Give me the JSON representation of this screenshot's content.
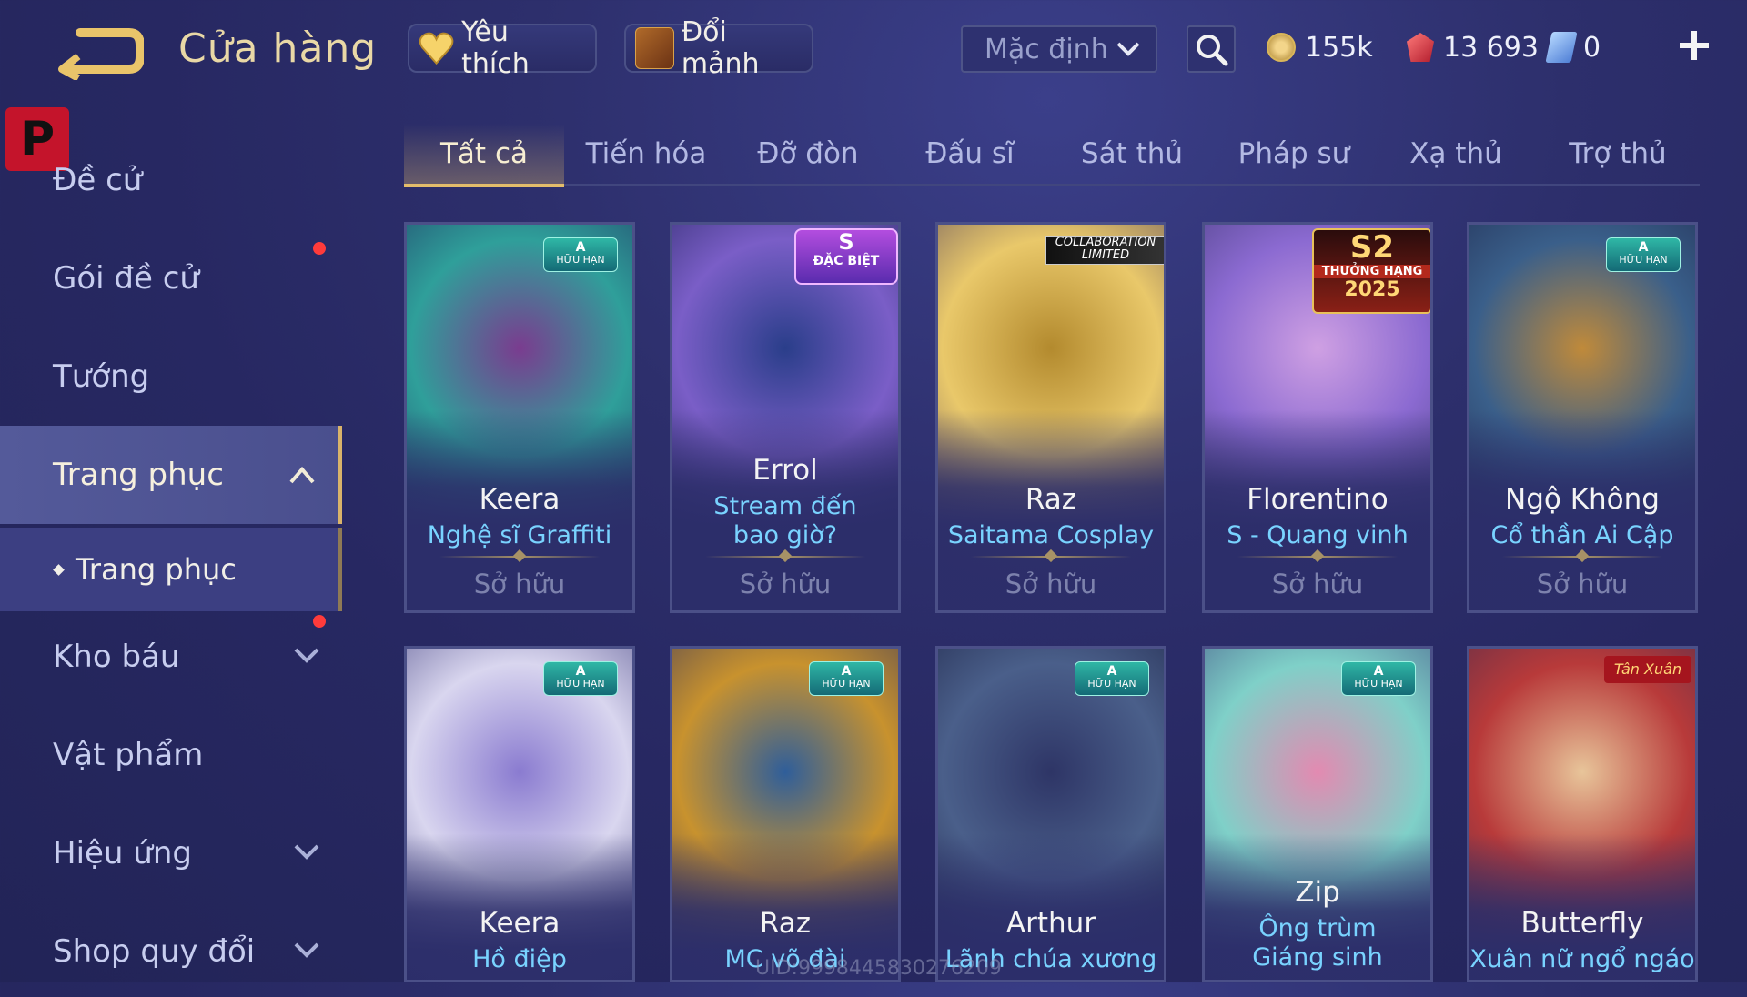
{
  "header": {
    "title": "Cửa hàng",
    "favorites_label": "Yêu thích",
    "shards_label": "Đổi mảnh",
    "sort": {
      "selected": "Mặc định"
    },
    "currencies": {
      "gold": "155k",
      "ruby": "13 693",
      "voucher": "0"
    }
  },
  "sidebar": {
    "logo_letter": "P",
    "items": [
      {
        "label": "Đề cử"
      },
      {
        "label": "Gói đề cử"
      },
      {
        "label": "Tướng"
      },
      {
        "label": "Trang phục"
      },
      {
        "label": "Trang phục"
      },
      {
        "label": "Kho báu"
      },
      {
        "label": "Vật phẩm"
      },
      {
        "label": "Hiệu ứng"
      },
      {
        "label": "Shop quy đổi"
      }
    ]
  },
  "tabs": [
    {
      "label": "Tất cả"
    },
    {
      "label": "Tiến hóa"
    },
    {
      "label": "Đỡ đòn"
    },
    {
      "label": "Đấu sĩ"
    },
    {
      "label": "Sát thủ"
    },
    {
      "label": "Pháp sư"
    },
    {
      "label": "Xạ thủ"
    },
    {
      "label": "Trợ thủ"
    }
  ],
  "cards": [
    {
      "hero": "Keera",
      "skin": "Nghệ sĩ Graffiti",
      "status": "Sở hữu",
      "badge_tier": "A",
      "badge_text": "HỮU HẠN",
      "art": [
        "#2f9f9a",
        "#7a3c8f",
        "#1f2a5e"
      ]
    },
    {
      "hero": "Errol",
      "skin": "Stream đến bao giờ?",
      "status": "Sở hữu",
      "badge_tier": "S",
      "badge_text": "ĐẶC BIỆT",
      "art": [
        "#7a5ec7",
        "#2a3e8a",
        "#1b1f55"
      ]
    },
    {
      "hero": "Raz",
      "skin": "Saitama Cosplay",
      "status": "Sở hữu",
      "badge_text": "COLLABORATION LIMITED",
      "art": [
        "#e9c86a",
        "#b38a2e",
        "#4a3a5c"
      ]
    },
    {
      "hero": "Florentino",
      "skin": "S - Quang vinh",
      "status": "Sở hữu",
      "badge_tier": "S2",
      "badge_text": "THƯỞNG HẠNG",
      "badge_year": "2025",
      "art": [
        "#8b6ad1",
        "#cfa0e3",
        "#3a356e"
      ]
    },
    {
      "hero": "Ngộ Không",
      "skin": "Cổ thần Ai Cập",
      "status": "Sở hữu",
      "badge_tier": "A",
      "badge_text": "HỮU HẠN",
      "art": [
        "#3a5f8a",
        "#c08a3a",
        "#1c2348"
      ]
    },
    {
      "hero": "Keera",
      "skin": "Hồ điệp",
      "status": "",
      "badge_tier": "A",
      "badge_text": "HỮU HẠN",
      "art": [
        "#d9d6ef",
        "#8a7bd0",
        "#3b3a7a"
      ]
    },
    {
      "hero": "Raz",
      "skin": "MC võ đài",
      "status": "",
      "badge_tier": "A",
      "badge_text": "HỮU HẠN",
      "art": [
        "#c8922e",
        "#2f5e9a",
        "#2a2c5e"
      ]
    },
    {
      "hero": "Arthur",
      "skin": "Lãnh chúa xương",
      "status": "",
      "badge_tier": "A",
      "badge_text": "HỮU HẠN",
      "art": [
        "#4a5f8a",
        "#2e3566",
        "#181c3e"
      ]
    },
    {
      "hero": "Zip",
      "skin": "Ông trùm Giáng sinh",
      "status": "",
      "badge_tier": "A",
      "badge_text": "HỮU HẠN",
      "art": [
        "#7fd0c8",
        "#e38ab1",
        "#3a3f7a"
      ]
    },
    {
      "hero": "Butterfly",
      "skin": "Xuân nữ ngổ ngáo",
      "status": "",
      "badge_text": "Tân Xuân",
      "art": [
        "#b83a3a",
        "#e8c59a",
        "#3a2a4e"
      ]
    }
  ],
  "uid": "UID:9998445830276209",
  "colors": {
    "accent_gold": "#e3bd6b",
    "skin_name": "#79d3ff",
    "notification": "#ff3b3b"
  }
}
